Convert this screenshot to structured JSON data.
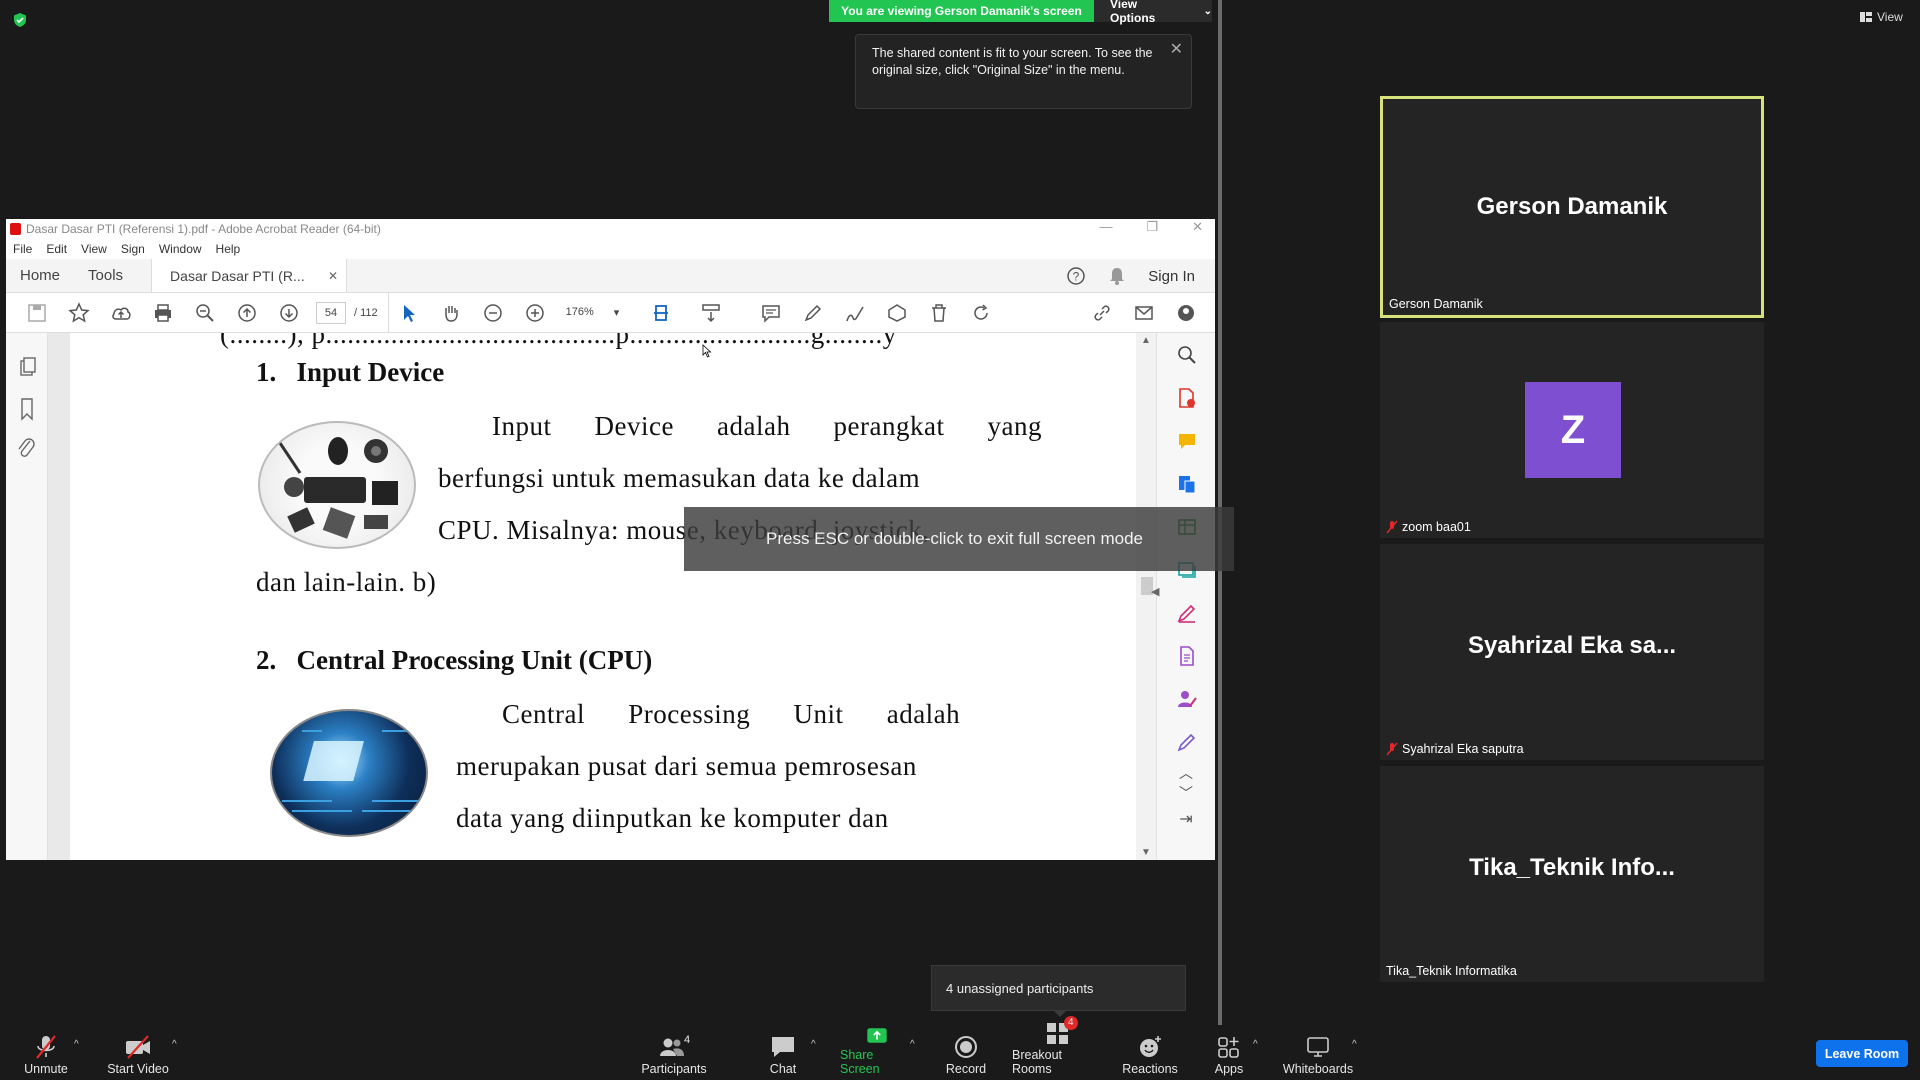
{
  "top": {
    "viewing_banner": "You are viewing Gerson Damanik's screen",
    "view_options": "View Options",
    "notice": "The shared content is fit to your screen. To see the original size, click \"Original Size\" in the menu.",
    "view_label": "View"
  },
  "acrobat": {
    "title": "Dasar Dasar PTI (Referensi 1).pdf - Adobe Acrobat Reader (64-bit)",
    "menu": [
      "File",
      "Edit",
      "View",
      "Sign",
      "Window",
      "Help"
    ],
    "tabs": {
      "home": "Home",
      "tools": "Tools",
      "doc": "Dasar Dasar PTI (R...",
      "sign_in": "Sign In"
    },
    "page_number": "54",
    "page_total": "/ 112",
    "zoom": "176%"
  },
  "document": {
    "h1": "1.   Input Device",
    "p1": [
      "Input Device adalah perangkat yang",
      "berfungsi untuk memasukan data ke dalam",
      "CPU. Misalnya: mouse, keyboard, joystick,",
      "dan lain-lain. b)"
    ],
    "h2": "2.   Central Processing Unit (CPU)",
    "p2": [
      "Central Processing Unit adalah",
      "merupakan pusat dari semua pemrosesan",
      "data yang diinputkan ke komputer dan"
    ]
  },
  "overlay": {
    "esc": "Press ESC or double-click to exit full screen mode"
  },
  "gallery": [
    {
      "display": "Gerson Damanik",
      "label": "Gerson Damanik"
    },
    {
      "initial": "Z",
      "label": "zoom baa01"
    },
    {
      "display": "Syahrizal Eka sa...",
      "label": "Syahrizal Eka saputra"
    },
    {
      "display": "Tika_Teknik Info...",
      "label": "Tika_Teknik Informatika"
    }
  ],
  "unassigned": "4 unassigned participants",
  "bottom": {
    "unmute": "Unmute",
    "start_video": "Start Video",
    "participants": "Participants",
    "participants_count": "4",
    "chat": "Chat",
    "share_screen": "Share Screen",
    "record": "Record",
    "breakout_rooms": "Breakout Rooms",
    "breakout_badge": "4",
    "reactions": "Reactions",
    "apps": "Apps",
    "whiteboards": "Whiteboards",
    "leave": "Leave Room"
  },
  "colors": {
    "share_green": "#23c552",
    "leave_blue": "#0e72ed",
    "active_speaker": "#d8e27a",
    "avatar_purple": "#7f4fd1"
  }
}
